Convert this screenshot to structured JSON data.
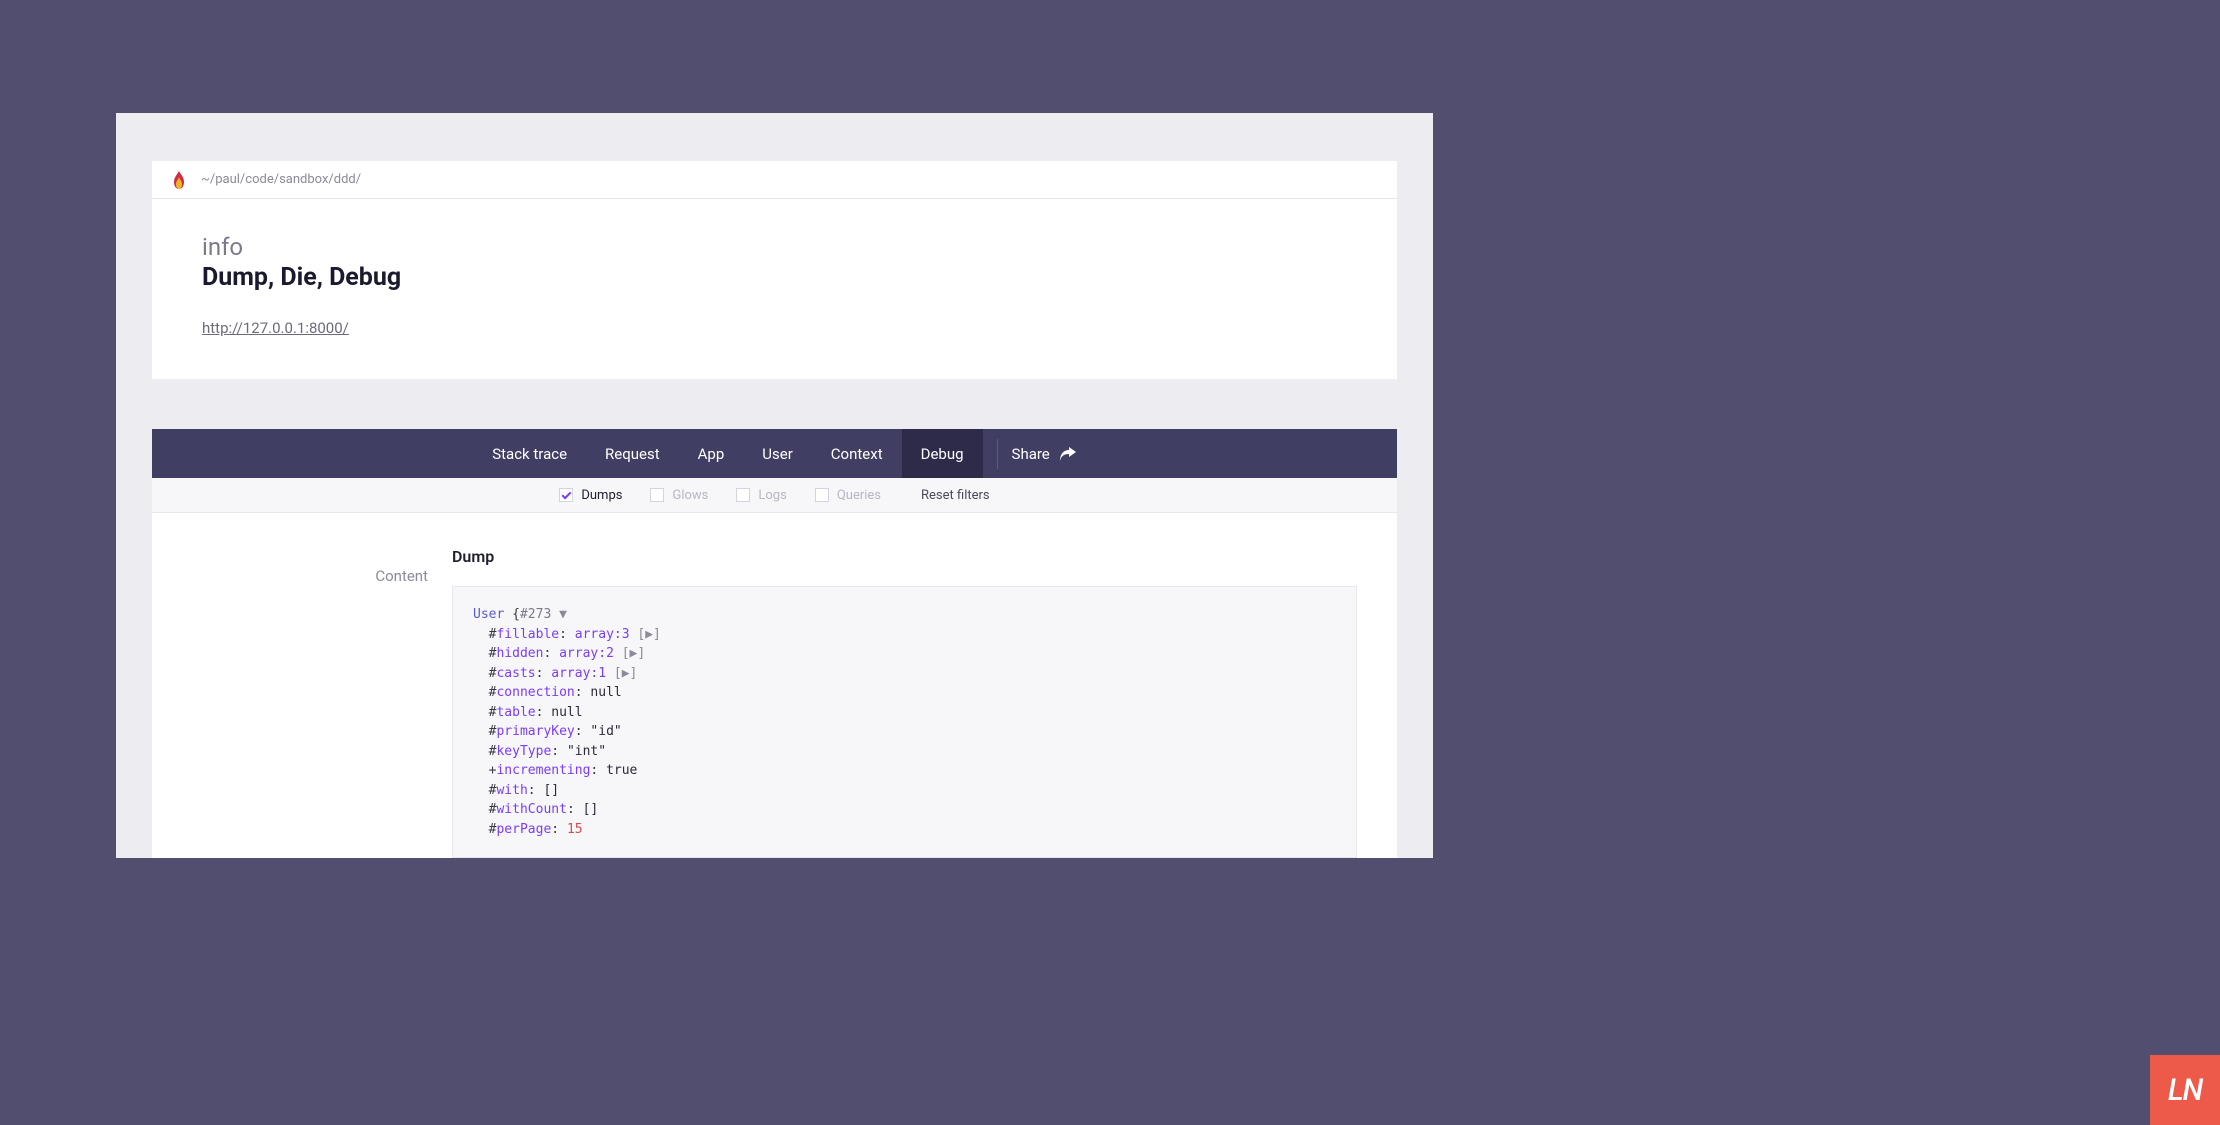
{
  "header": {
    "path": "~/paul/code/sandbox/ddd/"
  },
  "info": {
    "label": "info",
    "title": "Dump, Die, Debug",
    "url": "http://127.0.0.1:8000/"
  },
  "nav": {
    "items": [
      {
        "label": "Stack trace",
        "active": false
      },
      {
        "label": "Request",
        "active": false
      },
      {
        "label": "App",
        "active": false
      },
      {
        "label": "User",
        "active": false
      },
      {
        "label": "Context",
        "active": false
      },
      {
        "label": "Debug",
        "active": true
      }
    ],
    "share": "Share"
  },
  "filters": {
    "items": [
      {
        "label": "Dumps",
        "checked": true,
        "disabled": false
      },
      {
        "label": "Glows",
        "checked": false,
        "disabled": true
      },
      {
        "label": "Logs",
        "checked": false,
        "disabled": true
      },
      {
        "label": "Queries",
        "checked": false,
        "disabled": true
      }
    ],
    "reset": "Reset filters"
  },
  "dump": {
    "heading": "Dump",
    "content_label": "Content",
    "code": {
      "class": "User",
      "hash": "#273",
      "toggle": "▼",
      "fields": [
        {
          "vis": "#",
          "name": "fillable",
          "value": "array:3",
          "expand": true
        },
        {
          "vis": "#",
          "name": "hidden",
          "value": "array:2",
          "expand": true
        },
        {
          "vis": "#",
          "name": "casts",
          "value": "array:1",
          "expand": true
        },
        {
          "vis": "#",
          "name": "connection",
          "value": "null"
        },
        {
          "vis": "#",
          "name": "table",
          "value": "null"
        },
        {
          "vis": "#",
          "name": "primaryKey",
          "value": "\"id\""
        },
        {
          "vis": "#",
          "name": "keyType",
          "value": "\"int\""
        },
        {
          "vis": "+",
          "name": "incrementing",
          "value": "true"
        },
        {
          "vis": "#",
          "name": "with",
          "value": "[]"
        },
        {
          "vis": "#",
          "name": "withCount",
          "value": "[]"
        },
        {
          "vis": "#",
          "name": "perPage",
          "value": "15",
          "num": true
        }
      ]
    }
  },
  "watermark": "LN"
}
